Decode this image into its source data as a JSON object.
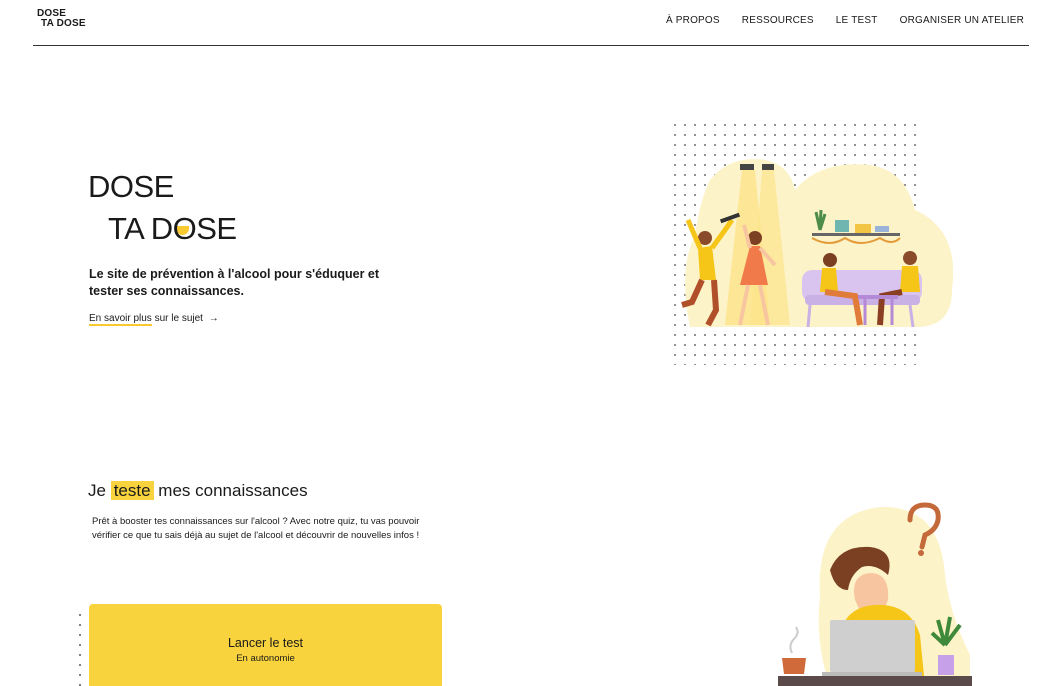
{
  "header": {
    "logo_line1": "DOSE",
    "logo_line2": "TA DOSE",
    "nav": [
      "À PROPOS",
      "RESSOURCES",
      "LE TEST",
      "ORGANISER UN ATELIER"
    ]
  },
  "hero": {
    "title_line1": "DOSE",
    "title_line2_a": "TA D",
    "title_line2_o": "O",
    "title_line2_b": "SE",
    "subtitle": "Le site de prévention à l'alcool pour s'éduquer et tester ses connaissances.",
    "link_underlined": "En savoir plus",
    "link_rest": "sur le sujet",
    "link_arrow": "→"
  },
  "quiz_section": {
    "title_before": "Je",
    "title_highlight": "teste",
    "title_after": "mes connaissances",
    "description": "Prêt à booster tes connaissances sur l'alcool ? Avec notre quiz, tu vas pouvoir vérifier ce que tu sais déjà au sujet de l'alcool et découvrir de nouvelles infos !",
    "cta_title": "Lancer le test",
    "cta_subtitle": "En autonomie"
  },
  "colors": {
    "accent": "#f9d33d",
    "text": "#1a1a1a",
    "illustration_pale": "#fdf3c8"
  },
  "icons": [
    "arrow-right-icon",
    "question-mark-icon",
    "laptop-icon",
    "coffee-cup-icon",
    "plant-icon"
  ]
}
